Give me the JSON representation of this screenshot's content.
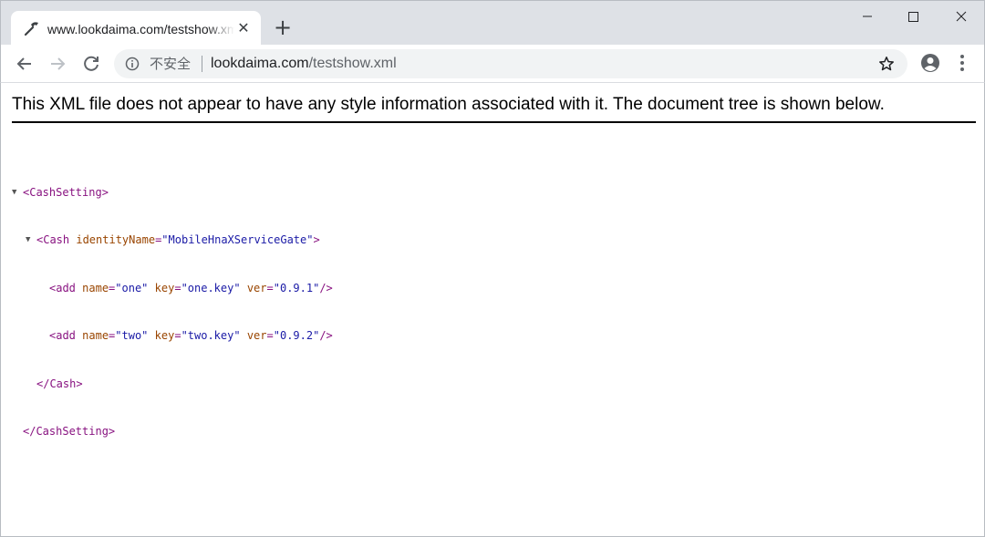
{
  "tab": {
    "title": "www.lookdaima.com/testshow.xml",
    "close_symbol": "✕",
    "favicon": "tools-icon"
  },
  "new_tab_symbol": "+",
  "window_controls": {
    "minimize": "─",
    "maximize": "☐",
    "close": "✕"
  },
  "toolbar": {
    "security_label": "不安全",
    "url_host": "lookdaima.com",
    "url_path": "/testshow.xml"
  },
  "notice": "This XML file does not appear to have any style information associated with it. The document tree is shown below.",
  "xml": {
    "root_open": "<CashSetting>",
    "cash_open_tag": "<Cash",
    "cash_attr_name": "identityName",
    "cash_attr_value": "\"MobileHnaXServiceGate\"",
    "cash_open_end": ">",
    "add1": {
      "tag": "<add",
      "n1": "name",
      "v1": "\"one\"",
      "n2": "key",
      "v2": "\"one.key\"",
      "n3": "ver",
      "v3": "\"0.9.1\"",
      "end": "/>"
    },
    "add2": {
      "tag": "<add",
      "n1": "name",
      "v1": "\"two\"",
      "n2": "key",
      "v2": "\"two.key\"",
      "n3": "ver",
      "v3": "\"0.9.2\"",
      "end": "/>"
    },
    "cash_close": "</Cash>",
    "root_close": "</CashSetting>",
    "toggle_symbol": "▼"
  },
  "colors": {
    "tag": "#881280",
    "attr_name": "#994500",
    "attr_value": "#1a1aa6",
    "chrome_bg": "#dee1e6"
  }
}
